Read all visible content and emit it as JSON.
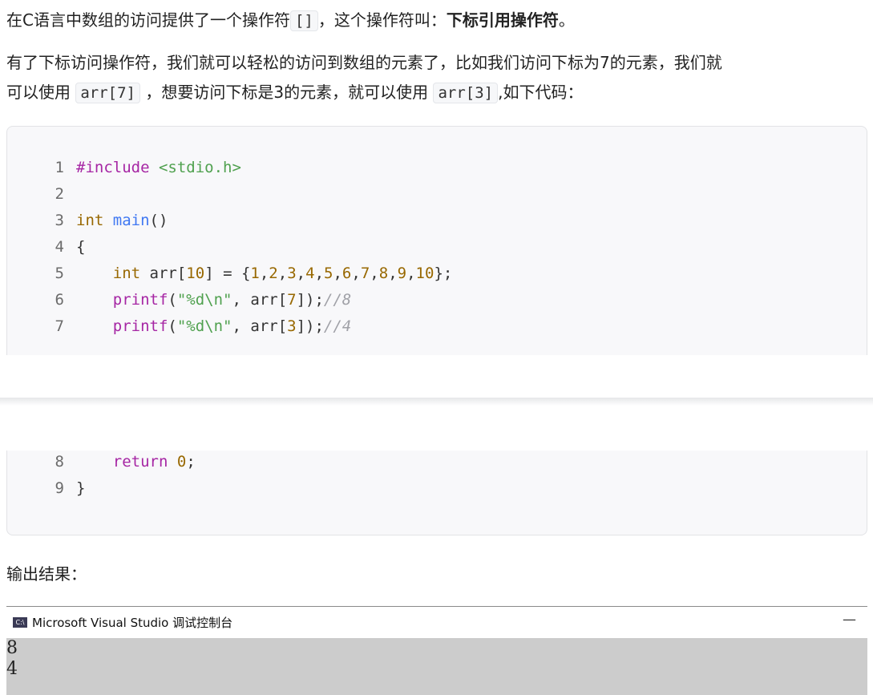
{
  "intro": {
    "p1_part1": "在C语言中数组的访问提供了一个操作符",
    "p1_code": "[]",
    "p1_part2": "，这个操作符叫：",
    "p1_bold": "下标引用操作符",
    "p1_end": "。",
    "p2_line1": "有了下标访问操作符，我们就可以轻松的访问到数组的元素了，比如我们访问下标为7的元素，我们就",
    "p2_part1": "可以使用",
    "p2_code1": "arr[7]",
    "p2_part2": "，想要访问下标是3的元素，就可以使用",
    "p2_code2": "arr[3]",
    "p2_part3": ",如下代码："
  },
  "code": {
    "l1_num": "1",
    "l1_kw": "#include",
    "l1_str": "<stdio.h>",
    "l2_num": "2",
    "l3_num": "3",
    "l3_type": "int",
    "l3_fn": "main",
    "l3_rest": "()",
    "l4_num": "4",
    "l4_text": "{",
    "l5_num": "5",
    "l5_type": "int",
    "l5_a": " arr[",
    "l5_n": "10",
    "l5_b": "] = {",
    "l5_v1": "1",
    "l5_v2": "2",
    "l5_v3": "3",
    "l5_v4": "4",
    "l5_v5": "5",
    "l5_v6": "6",
    "l5_v7": "7",
    "l5_v8": "8",
    "l5_v9": "9",
    "l5_v10": "10",
    "l5_end": "};",
    "l6_num": "6",
    "l6_fn": "printf",
    "l6_str": "\"%d\\n\"",
    "l6_a": ", arr[",
    "l6_n": "7",
    "l6_b": "]);",
    "l6_cm": "//8",
    "l7_num": "7",
    "l7_fn": "printf",
    "l7_str": "\"%d\\n\"",
    "l7_a": ", arr[",
    "l7_n": "3",
    "l7_b": "]);",
    "l7_cm": "//4",
    "l8_num": "8",
    "l8_kw": "return",
    "l8_n": "0",
    "l8_end": ";",
    "l9_num": "9",
    "l9_text": "}"
  },
  "output_heading": "输出结果：",
  "console": {
    "icon_text": "C:\\",
    "title": "Microsoft Visual Studio 调试控制台",
    "minimize": "—",
    "line1": "8",
    "line2": "4"
  }
}
